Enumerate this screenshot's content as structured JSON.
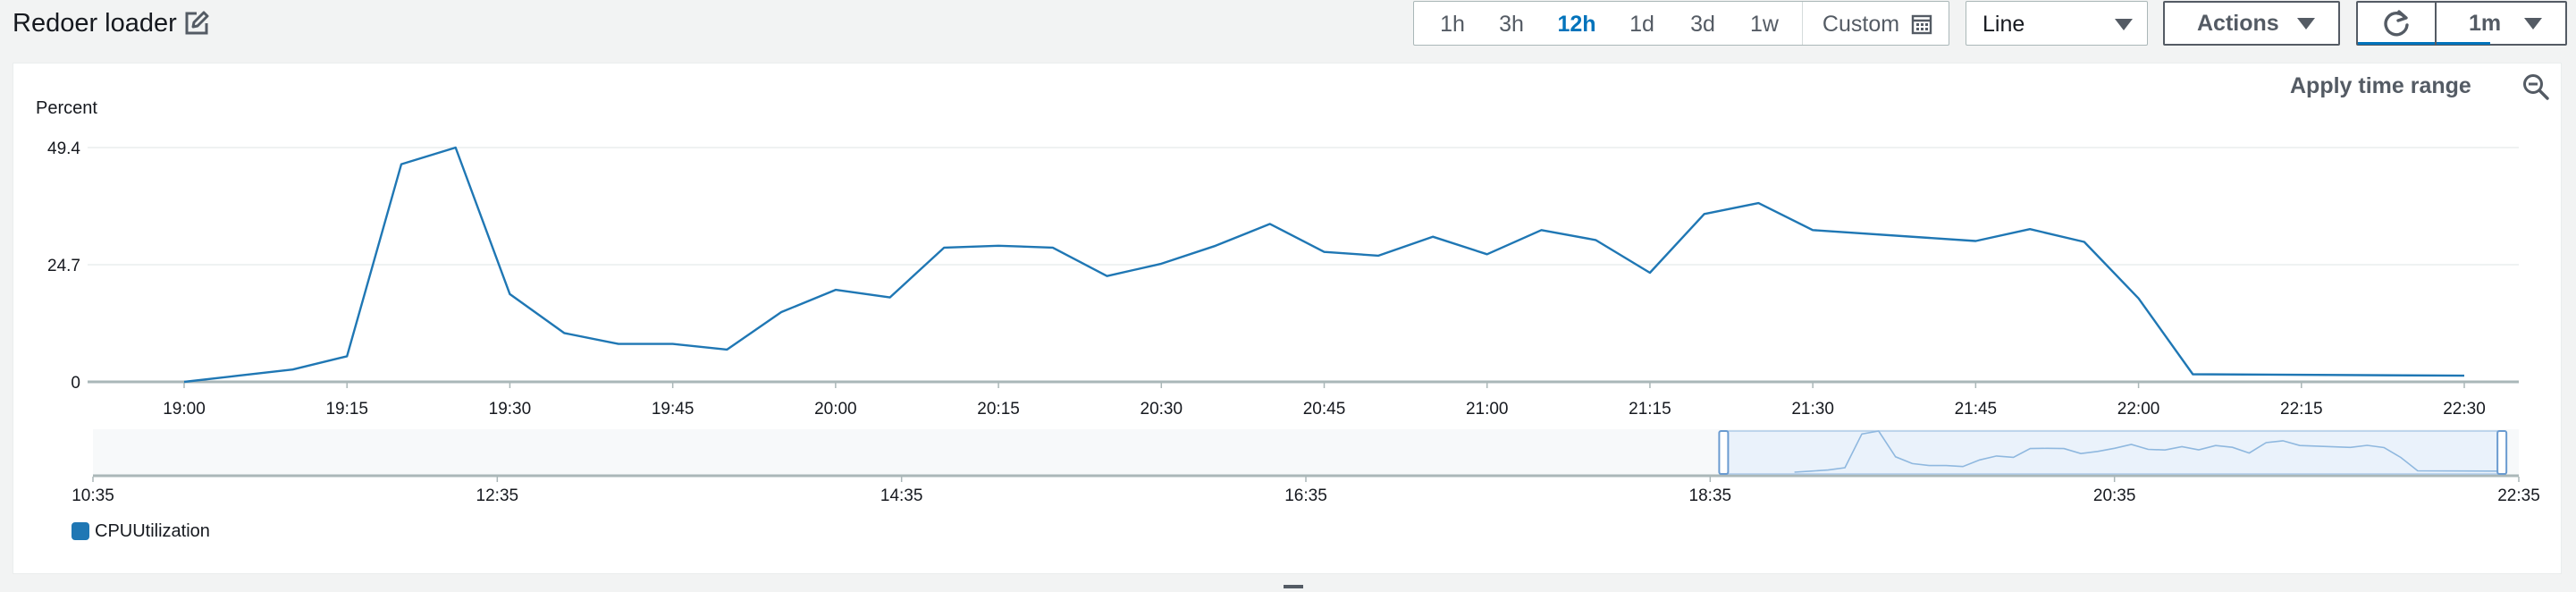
{
  "widget": {
    "title": "Redoer loader"
  },
  "time_range": {
    "options": [
      "1h",
      "3h",
      "12h",
      "1d",
      "3d",
      "1w"
    ],
    "active": "12h",
    "custom_label": "Custom"
  },
  "chart_type_select": {
    "value": "Line"
  },
  "actions": {
    "label": "Actions"
  },
  "refresh": {
    "interval": "1m"
  },
  "panel": {
    "apply_time_range_label": "Apply time range"
  },
  "colors": {
    "series": "#1f77b4",
    "accent": "#0073bb",
    "grid": "#eaeded"
  },
  "chart_data": {
    "type": "line",
    "ylabel": "Percent",
    "yticks": [
      0,
      24.7,
      49.4
    ],
    "ylim": [
      0,
      49.4
    ],
    "xlim": [
      "19:00",
      "22:30"
    ],
    "xticks": [
      "19:00",
      "19:15",
      "19:30",
      "19:45",
      "20:00",
      "20:15",
      "20:30",
      "20:45",
      "21:00",
      "21:15",
      "21:30",
      "21:45",
      "22:00",
      "22:15",
      "22:30"
    ],
    "grid": true,
    "legend": "bottom-left",
    "series": [
      {
        "name": "CPUUtilization",
        "x": [
          "19:00",
          "19:05",
          "19:10",
          "19:15",
          "19:20",
          "19:25",
          "19:30",
          "19:35",
          "19:40",
          "19:45",
          "19:50",
          "19:55",
          "20:00",
          "20:05",
          "20:10",
          "20:15",
          "20:20",
          "20:25",
          "20:30",
          "20:35",
          "20:40",
          "20:45",
          "20:50",
          "20:55",
          "21:00",
          "21:05",
          "21:10",
          "21:15",
          "21:20",
          "21:25",
          "21:30",
          "21:45",
          "21:50",
          "21:55",
          "22:00",
          "22:05",
          "22:30"
        ],
        "values": [
          0,
          1.3,
          2.6,
          5.4,
          45.9,
          49.4,
          18.5,
          10.3,
          8.0,
          8.0,
          6.8,
          14.7,
          19.4,
          17.8,
          28.3,
          28.7,
          28.3,
          22.3,
          24.9,
          28.7,
          33.3,
          27.4,
          26.6,
          30.6,
          26.9,
          32.0,
          29.9,
          23.0,
          35.4,
          37.7,
          32.0,
          29.7,
          32.2,
          29.5,
          17.6,
          1.6,
          1.3
        ]
      }
    ],
    "overview": {
      "ticks": [
        "10:35",
        "12:35",
        "14:35",
        "16:35",
        "18:35",
        "20:35",
        "22:35"
      ],
      "xlim": [
        "10:35",
        "22:35"
      ],
      "selection": [
        "18:39",
        "22:30"
      ]
    }
  }
}
